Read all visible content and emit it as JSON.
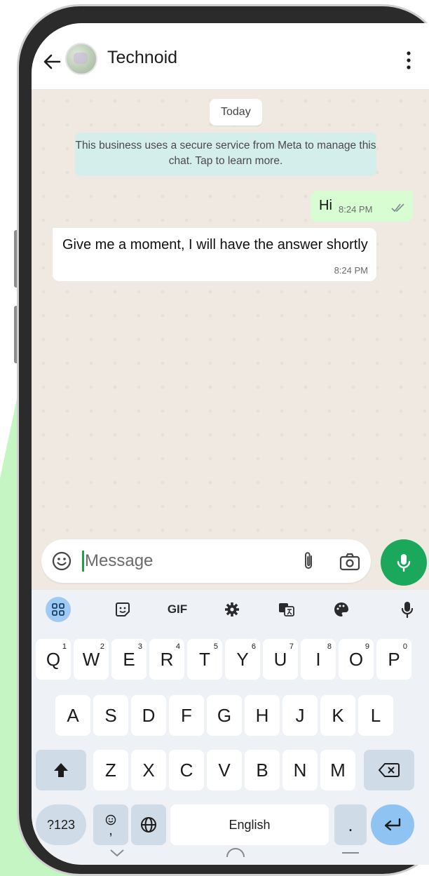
{
  "header": {
    "title": "Technoid"
  },
  "chat": {
    "date_chip": "Today",
    "system_note": "This business uses a secure service from Meta to manage this chat. Tap to learn more.",
    "messages": [
      {
        "direction": "out",
        "text": "Hi",
        "time": "8:24 PM",
        "status": "read"
      },
      {
        "direction": "in",
        "text": "Give me a moment, I will have the answer shortly",
        "time": "8:24 PM"
      }
    ]
  },
  "composer": {
    "placeholder": "Message"
  },
  "keyboard": {
    "toolbar": [
      "apps-icon",
      "sticker-icon",
      "GIF",
      "gear-icon",
      "translate-icon",
      "palette-icon",
      "mic-icon"
    ],
    "gif_label": "GIF",
    "row1": [
      {
        "key": "Q",
        "hint": "1"
      },
      {
        "key": "W",
        "hint": "2"
      },
      {
        "key": "E",
        "hint": "3"
      },
      {
        "key": "R",
        "hint": "4"
      },
      {
        "key": "T",
        "hint": "5"
      },
      {
        "key": "Y",
        "hint": "6"
      },
      {
        "key": "U",
        "hint": "7"
      },
      {
        "key": "I",
        "hint": "8"
      },
      {
        "key": "O",
        "hint": "9"
      },
      {
        "key": "P",
        "hint": "0"
      }
    ],
    "row2": [
      "A",
      "S",
      "D",
      "F",
      "G",
      "H",
      "J",
      "K",
      "L"
    ],
    "row3": [
      "Z",
      "X",
      "C",
      "V",
      "B",
      "N",
      "M"
    ],
    "sym_label": "?123",
    "space_label": "English",
    "period_label": "."
  },
  "colors": {
    "accent_green": "#1ca85c",
    "outgoing_bubble": "#d9fdd3",
    "system_note_bg": "#d4eeeb",
    "enter_key": "#8fc4f2"
  }
}
